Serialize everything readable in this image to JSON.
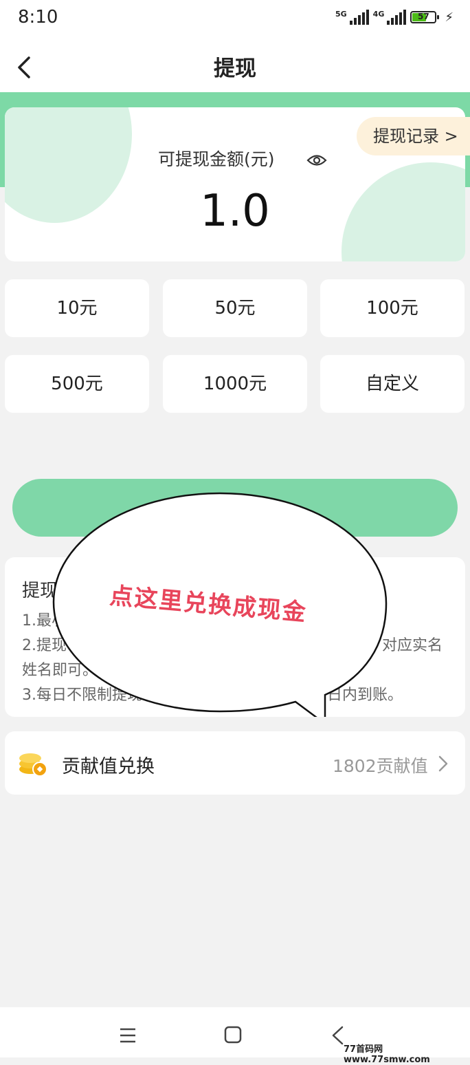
{
  "status_bar": {
    "time": "8:10",
    "net1": "5G",
    "net2": "4G",
    "battery": "57"
  },
  "header": {
    "title": "提现",
    "back_icon": "back-arrow-icon"
  },
  "balance_card": {
    "records_label": "提现记录 >",
    "label": "可提现金额(元)",
    "value": "1.0",
    "eye_icon": "eye-icon"
  },
  "amount_options": [
    "10元",
    "50元",
    "100元",
    "500元",
    "1000元",
    "自定义"
  ],
  "rules": {
    "title": "提现",
    "lines": [
      "1.最小",
      "2.提现",
      "对应实名",
      "姓名即可。",
      "3.每日不限制提现",
      "日内到账。"
    ]
  },
  "overlay": {
    "bubble_text": "点这里兑换成现金"
  },
  "contribution": {
    "label": "贡献值兑换",
    "value": "1802贡献值",
    "icon": "coin-stack-icon"
  },
  "navbar": {
    "icons": [
      "menu-icon",
      "home-icon",
      "back-icon"
    ]
  },
  "watermark": "77首码网 www.77smw.com",
  "colors": {
    "accent": "#7dd9a6",
    "button": "#7fd7a8",
    "bubble_text": "#e8455b"
  }
}
